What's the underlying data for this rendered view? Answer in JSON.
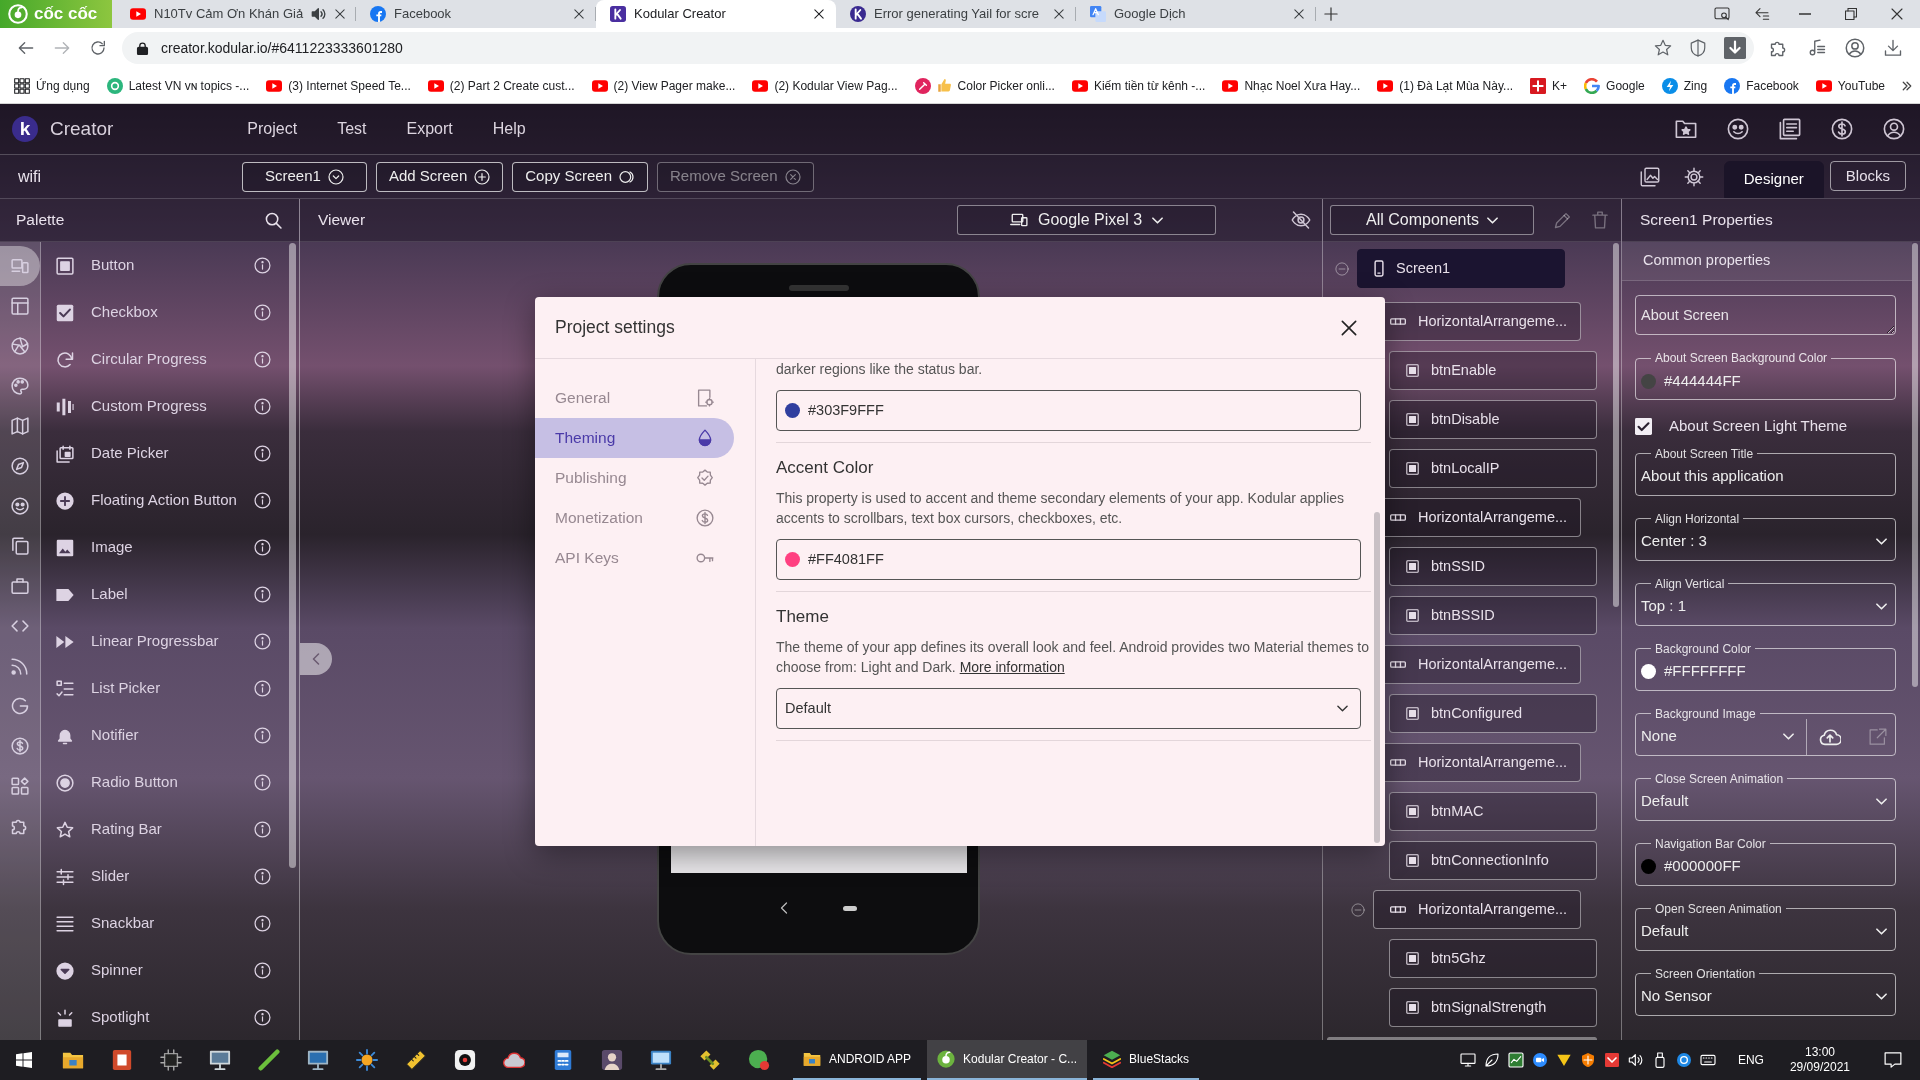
{
  "browser": {
    "home_button": "cốc cốc",
    "tabs": [
      {
        "title": "N10Tv Cảm Ơn Khán Giả",
        "audio": true,
        "selected": false
      },
      {
        "title": "Facebook",
        "audio": false,
        "selected": false
      },
      {
        "title": "Kodular Creator",
        "audio": false,
        "selected": true
      },
      {
        "title": "Error generating Yail for scre",
        "audio": false,
        "selected": false
      },
      {
        "title": "Google Dịch",
        "audio": false,
        "selected": false
      }
    ],
    "address": "creator.kodular.io/#6411223333601280",
    "bookmarks": [
      "Ứng dụng",
      "Latest VN ᴠɴ topics -...",
      "(3) Internet Speed Te...",
      "(2) Part 2 Create cust...",
      "(2) View Pager make...",
      "(2) Kodular View Pag...",
      "Color Picker onli...",
      "Kiếm tiền từ kênh -...",
      "Nhạc Noel Xưa Hay...",
      "(1) Đà Lạt Mùa Này...",
      "K+",
      "Google",
      "Zing",
      "Facebook",
      "YouTube"
    ]
  },
  "app": {
    "logo": "k",
    "title": "Creator",
    "menu": [
      "Project",
      "Test",
      "Export",
      "Help"
    ],
    "project": "wifi",
    "screen_buttons": [
      {
        "label": "Screen1",
        "disabled": false
      },
      {
        "label": "Add Screen",
        "disabled": false
      },
      {
        "label": "Copy Screen",
        "disabled": false
      },
      {
        "label": "Remove Screen",
        "disabled": true
      }
    ],
    "editor_tabs": [
      {
        "label": "Designer",
        "selected": true
      },
      {
        "label": "Blocks",
        "selected": false
      }
    ]
  },
  "palette": {
    "title": "Palette",
    "categories": [
      {
        "selected": true
      },
      {
        "selected": false
      },
      {
        "selected": false
      },
      {
        "selected": false
      },
      {
        "selected": false
      },
      {
        "selected": false
      },
      {
        "selected": false
      },
      {
        "selected": false
      },
      {
        "selected": false
      },
      {
        "selected": false
      },
      {
        "selected": false
      },
      {
        "selected": false
      },
      {
        "selected": false
      },
      {
        "selected": false
      },
      {
        "selected": false
      }
    ],
    "items": [
      "Button",
      "Checkbox",
      "Circular Progress",
      "Custom Progress",
      "Date Picker",
      "Floating Action Button",
      "Image",
      "Label",
      "Linear Progressbar",
      "List Picker",
      "Notifier",
      "Radio Button",
      "Rating Bar",
      "Slider",
      "Snackbar",
      "Spinner",
      "Spotlight"
    ]
  },
  "viewer": {
    "title": "Viewer",
    "device": "Google Pixel 3"
  },
  "components": {
    "filter": "All Components",
    "tree": [
      {
        "name": "Screen1",
        "kind": "screen",
        "selected": true,
        "expanded": true,
        "children": [
          {
            "name": "HorizontalArrangeme...",
            "kind": "arrangement",
            "selected": false,
            "children": [
              {
                "name": "btnEnable",
                "kind": "button",
                "selected": false
              },
              {
                "name": "btnDisable",
                "kind": "button",
                "selected": false
              },
              {
                "name": "btnLocalIP",
                "kind": "button",
                "selected": false
              }
            ]
          },
          {
            "name": "HorizontalArrangeme...",
            "kind": "arrangement",
            "selected": false,
            "children": [
              {
                "name": "btnSSID",
                "kind": "button",
                "selected": false
              },
              {
                "name": "btnBSSID",
                "kind": "button",
                "selected": false
              }
            ]
          },
          {
            "name": "HorizontalArrangeme...",
            "kind": "arrangement",
            "selected": false,
            "children": [
              {
                "name": "btnConfigured",
                "kind": "button",
                "selected": false
              }
            ]
          },
          {
            "name": "HorizontalArrangeme...",
            "kind": "arrangement",
            "selected": false,
            "children": [
              {
                "name": "btnMAC",
                "kind": "button",
                "selected": false
              },
              {
                "name": "btnConnectionInfo",
                "kind": "button",
                "selected": false
              }
            ]
          },
          {
            "name": "HorizontalArrangeme...",
            "kind": "arrangement",
            "selected": false,
            "expanded": true,
            "children": [
              {
                "name": "btn5Ghz",
                "kind": "button",
                "selected": false
              },
              {
                "name": "btnSignalStrength",
                "kind": "button",
                "selected": false
              }
            ]
          }
        ]
      }
    ]
  },
  "properties": {
    "title": "Screen1 Properties",
    "section": "Common properties",
    "items": [
      {
        "kind": "textarea",
        "placeholder": "About Screen"
      },
      {
        "kind": "color",
        "label": "About Screen Background Color",
        "value": "#444444FF",
        "color": "#444444"
      },
      {
        "kind": "checkbox",
        "label": "About Screen Light Theme",
        "checked": true
      },
      {
        "kind": "text",
        "label": "About Screen Title",
        "value": "About this application"
      },
      {
        "kind": "select",
        "label": "Align Horizontal",
        "value": "Center : 3"
      },
      {
        "kind": "select",
        "label": "Align Vertical",
        "value": "Top : 1"
      },
      {
        "kind": "color",
        "label": "Background Color",
        "value": "#FFFFFFFF",
        "color": "#ffffff"
      },
      {
        "kind": "image",
        "label": "Background Image",
        "value": "None"
      },
      {
        "kind": "select",
        "label": "Close Screen Animation",
        "value": "Default"
      },
      {
        "kind": "color",
        "label": "Navigation Bar Color",
        "value": "#000000FF",
        "color": "#000000"
      },
      {
        "kind": "select",
        "label": "Open Screen Animation",
        "value": "Default"
      },
      {
        "kind": "select",
        "label": "Screen Orientation",
        "value": "No Sensor"
      }
    ]
  },
  "dialog": {
    "title": "Project settings",
    "nav": [
      {
        "label": "General",
        "selected": false
      },
      {
        "label": "Theming",
        "selected": true
      },
      {
        "label": "Publishing",
        "selected": false
      },
      {
        "label": "Monetization",
        "selected": false
      },
      {
        "label": "API Keys",
        "selected": false
      }
    ],
    "sections": [
      {
        "kind": "color",
        "description": "darker regions like the status bar.",
        "value": "#303F9FFF",
        "color": "#303f9f"
      },
      {
        "kind": "color",
        "heading": "Accent Color",
        "description": "This property is used to accent and theme secondary elements of your app. Kodular applies accents to scrollbars, text box cursors, checkboxes, etc.",
        "value": "#FF4081FF",
        "color": "#ff4081"
      },
      {
        "kind": "select",
        "heading": "Theme",
        "description": "The theme of your app defines its overall look and feel. Android provides two Material themes to choose from: Light and Dark.",
        "link": "More information",
        "value": "Default"
      }
    ]
  },
  "taskbar": {
    "windows": [
      {
        "label": "ANDROID APP",
        "selected": false
      },
      {
        "label": "Kodular Creator - C...",
        "selected": true
      },
      {
        "label": "BlueStacks",
        "selected": false
      }
    ],
    "language": "ENG",
    "time": "13:00",
    "date": "29/09/2021"
  }
}
